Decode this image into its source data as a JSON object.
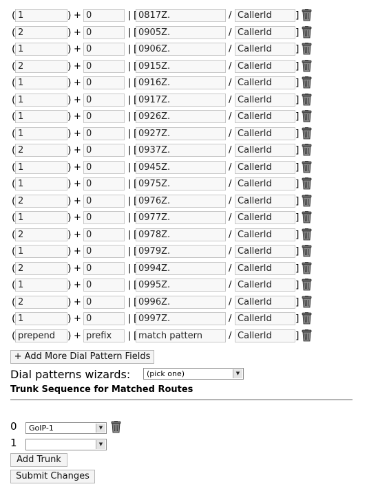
{
  "patterns": [
    {
      "prepend": "1",
      "prefix": "0",
      "match": "0817Z.",
      "callerid": "CallerId"
    },
    {
      "prepend": "2",
      "prefix": "0",
      "match": "0905Z.",
      "callerid": "CallerId"
    },
    {
      "prepend": "1",
      "prefix": "0",
      "match": "0906Z.",
      "callerid": "CallerId"
    },
    {
      "prepend": "2",
      "prefix": "0",
      "match": "0915Z.",
      "callerid": "CallerId"
    },
    {
      "prepend": "1",
      "prefix": "0",
      "match": "0916Z.",
      "callerid": "CallerId"
    },
    {
      "prepend": "1",
      "prefix": "0",
      "match": "0917Z.",
      "callerid": "CallerId"
    },
    {
      "prepend": "1",
      "prefix": "0",
      "match": "0926Z.",
      "callerid": "CallerId"
    },
    {
      "prepend": "1",
      "prefix": "0",
      "match": "0927Z.",
      "callerid": "CallerId"
    },
    {
      "prepend": "2",
      "prefix": "0",
      "match": "0937Z.",
      "callerid": "CallerId"
    },
    {
      "prepend": "1",
      "prefix": "0",
      "match": "0945Z.",
      "callerid": "CallerId"
    },
    {
      "prepend": "1",
      "prefix": "0",
      "match": "0975Z.",
      "callerid": "CallerId"
    },
    {
      "prepend": "2",
      "prefix": "0",
      "match": "0976Z.",
      "callerid": "CallerId"
    },
    {
      "prepend": "1",
      "prefix": "0",
      "match": "0977Z.",
      "callerid": "CallerId"
    },
    {
      "prepend": "2",
      "prefix": "0",
      "match": "0978Z.",
      "callerid": "CallerId"
    },
    {
      "prepend": "1",
      "prefix": "0",
      "match": "0979Z.",
      "callerid": "CallerId"
    },
    {
      "prepend": "2",
      "prefix": "0",
      "match": "0994Z.",
      "callerid": "CallerId"
    },
    {
      "prepend": "1",
      "prefix": "0",
      "match": "0995Z.",
      "callerid": "CallerId"
    },
    {
      "prepend": "2",
      "prefix": "0",
      "match": "0996Z.",
      "callerid": "CallerId"
    },
    {
      "prepend": "1",
      "prefix": "0",
      "match": "0997Z.",
      "callerid": "CallerId"
    },
    {
      "prepend": "prepend",
      "prefix": "prefix",
      "match": "match pattern",
      "callerid": "CallerId"
    }
  ],
  "symbols": {
    "open": "(",
    "close": ")",
    "plus": "+",
    "pipe": "|",
    "bracket_open": "[",
    "slash": "/",
    "bracket_close": "]"
  },
  "add_more_button": "+ Add More Dial Pattern Fields",
  "wizards": {
    "label": "Dial patterns wizards:",
    "selected": "(pick one)"
  },
  "trunk_section": {
    "heading": "Trunk Sequence for Matched Routes",
    "trunks": [
      {
        "index": "0",
        "selected": "GoIP-1"
      },
      {
        "index": "1",
        "selected": ""
      }
    ]
  },
  "add_trunk_button": "Add Trunk",
  "submit_button": "Submit Changes",
  "icons": {
    "delete": "trash-can-icon",
    "dropdown": "chevron-down-icon"
  }
}
